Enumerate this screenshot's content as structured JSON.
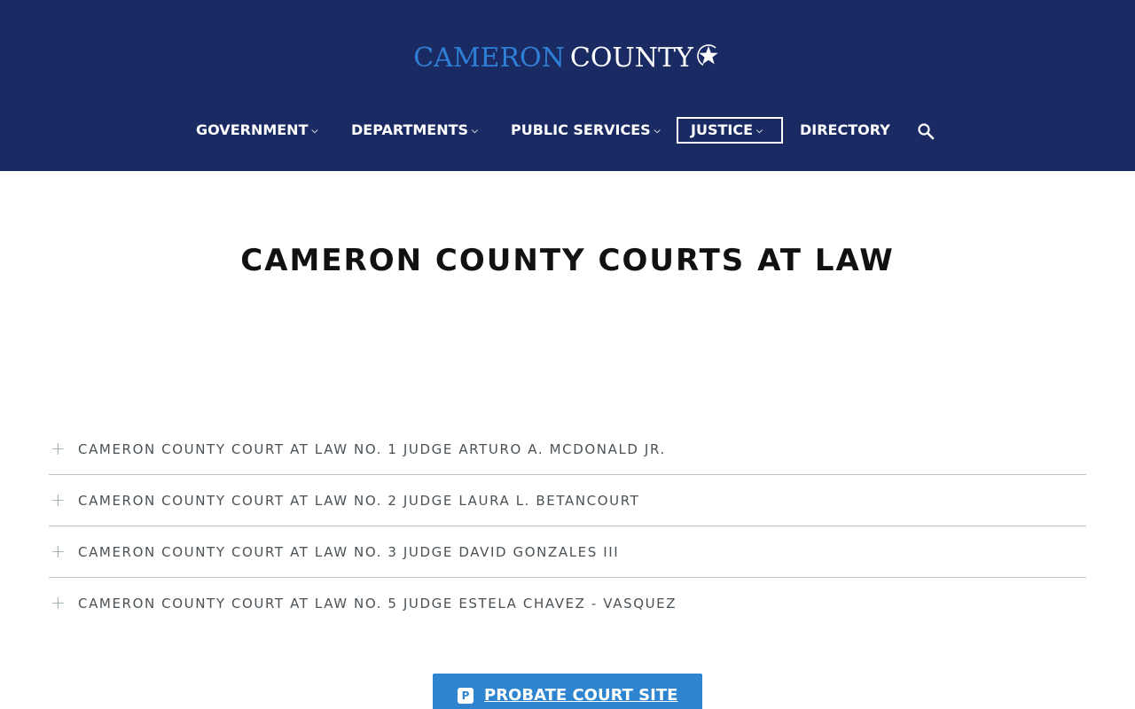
{
  "header": {
    "logo_part1": "CAMERON",
    "logo_part2": "COUNTY",
    "logo_icon": "star-icon",
    "brand_color": "#1a2b63",
    "accent_color": "#2f7fd6"
  },
  "nav": {
    "items": [
      {
        "label": "GOVERNMENT",
        "has_dropdown": true
      },
      {
        "label": "DEPARTMENTS",
        "has_dropdown": true
      },
      {
        "label": "PUBLIC SERVICES",
        "has_dropdown": true
      },
      {
        "label": "JUSTICE",
        "has_dropdown": true,
        "active": true
      },
      {
        "label": "DIRECTORY",
        "has_dropdown": false
      }
    ],
    "chevron_glyph": "⌵",
    "search_icon": "search-icon"
  },
  "main": {
    "title": "CAMERON COUNTY COURTS AT LAW",
    "accordion": [
      {
        "label": "CAMERON COUNTY COURT AT LAW NO. 1 JUDGE ARTURO A. MCDONALD JR."
      },
      {
        "label": "CAMERON COUNTY COURT AT LAW NO. 2 JUDGE LAURA L. BETANCOURT"
      },
      {
        "label": "CAMERON COUNTY COURT AT LAW NO. 3 JUDGE DAVID GONZALES III"
      },
      {
        "label": "CAMERON COUNTY COURT AT LAW NO. 5 JUDGE ESTELA CHAVEZ - VASQUEZ"
      }
    ],
    "accordion_toggle_glyph": "+",
    "probate_button": {
      "icon_letter": "P",
      "label": "PROBATE COURT SITE",
      "color": "#2f84d0"
    }
  }
}
